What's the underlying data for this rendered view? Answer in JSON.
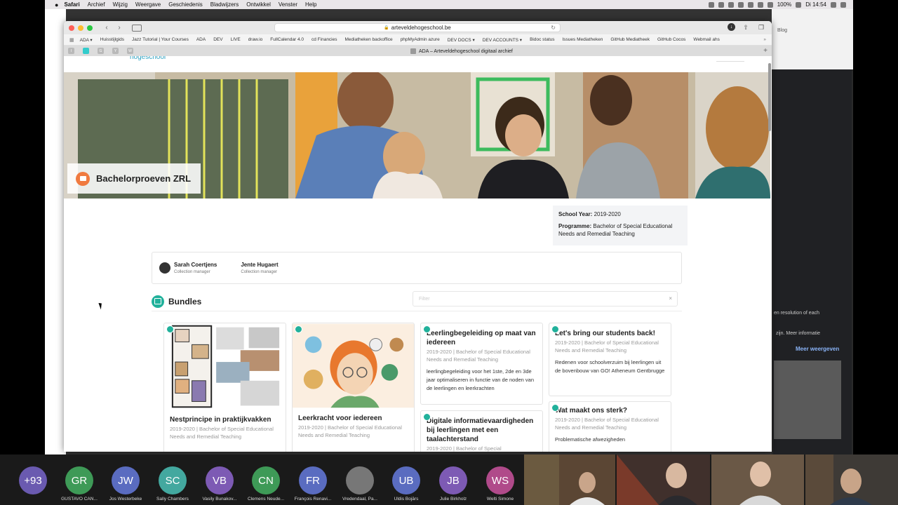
{
  "menubar": {
    "apple": "",
    "items": [
      "Safari",
      "Archief",
      "Wijzig",
      "Weergave",
      "Geschiedenis",
      "Bladwijzers",
      "Ontwikkel",
      "Venster",
      "Help"
    ],
    "battery": "100%",
    "clock": "Di 14:54"
  },
  "browser": {
    "url": "arteveldehogeschool.be",
    "bg_url": "react.semantic-ui.com",
    "bookmarks": [
      "ADA ▾",
      "Huisstijlgids",
      "Jazz Tutorial | Your Courses",
      "ADA",
      "DEV",
      "LIVE",
      "draw.io",
      "FullCalendar 4.0",
      "cd Financies",
      "Mediatheken backoffice",
      "phpMyAdmin azure",
      "DEV DOCS ▾",
      "DEV ACCOUNTS ▾",
      "Bidoc status",
      "Issues Mediatheken",
      "GitHub Mediatheek",
      "GitHub Cocos",
      "Webmail ahs"
    ],
    "pinned_tabs": [
      "I",
      "",
      "G",
      "Y",
      "W"
    ],
    "active_tab": "ADA – Arteveldehogeschool digitaal archief",
    "bookmarks_more": "»"
  },
  "page": {
    "logo_fragment": "hogeschool",
    "collection_title": "Bachelorproeven ZRL",
    "info": {
      "school_year_label": "School Year:",
      "school_year": "2019-2020",
      "programme_label": "Programme:",
      "programme": "Bachelor of Special Educational Needs and Remedial Teaching"
    },
    "managers": [
      {
        "name": "Sarah Coertjens",
        "role": "Collection manager"
      },
      {
        "name": "Jente Hugaert",
        "role": "Collection manager"
      }
    ],
    "bundles_title": "Bundles",
    "filter_placeholder": "Filter",
    "filter_clear": "×",
    "cards": [
      {
        "title": "Nestprincipe in praktijkvakken",
        "meta": "2019-2020 | Bachelor of Special Educational Needs and Remedial Teaching",
        "desc": ""
      },
      {
        "title": "Leerkracht voor iedereen",
        "meta": "2019-2020 | Bachelor of Special Educational Needs and Remedial Teaching",
        "desc": ""
      },
      {
        "title": "Leerlingbegeleiding op maat van iedereen",
        "meta": "2019-2020 | Bachelor of Special Educational Needs and Remedial Teaching",
        "desc": "leerlingbegeleiding voor het 1ste, 2de en 3de jaar optimaliseren in functie van de noden van de leerlingen en leerkrachten"
      },
      {
        "title": "Let's bring our students back!",
        "meta": "2019-2020 | Bachelor of Special Educational Needs and Remedial Teaching",
        "desc": "Redenen voor schoolverzuim bij leerlingen uit de bovenbouw van GO! Atheneum Gentbrugge"
      },
      {
        "title": "Digitale informatievaardigheden bij leerlingen met een taalachterstand",
        "meta": "2019-2020 | Bachelor of Special",
        "desc": ""
      },
      {
        "title": "Wat maakt ons sterk?",
        "meta": "2019-2020 | Bachelor of Special Educational Needs and Remedial Teaching",
        "desc": "Problematische afwezigheden"
      }
    ]
  },
  "background_window": {
    "tab_label": "Blog",
    "text1": "en resolution of each",
    "text2": "zijn. Meer informatie",
    "link": "Meer weergeven"
  },
  "zoom": {
    "more_count": "+93",
    "participants": [
      {
        "initials": "GR",
        "name": "GUSTAVO CAN...",
        "color": "#3e9a57"
      },
      {
        "initials": "JW",
        "name": "Jos Westerbeke",
        "color": "#5a6cc0"
      },
      {
        "initials": "SC",
        "name": "Sally Chambers",
        "color": "#43a89f"
      },
      {
        "initials": "VB",
        "name": "Vasily Bunakov...",
        "color": "#7d5ab4"
      },
      {
        "initials": "CN",
        "name": "Clemens Neude...",
        "color": "#3e9a57"
      },
      {
        "initials": "FR",
        "name": "François Renavi...",
        "color": "#5a6cc0"
      },
      {
        "initials": "",
        "name": "Vredendaal, Pa...",
        "color": "#777777"
      },
      {
        "initials": "UB",
        "name": "Uldis Bojārs",
        "color": "#5a6cc0"
      },
      {
        "initials": "JB",
        "name": "Julie Birkholz",
        "color": "#7d5ab4"
      },
      {
        "initials": "WS",
        "name": "Welti Simone",
        "color": "#b04a8a"
      }
    ],
    "more_color": "#6a5ab0"
  },
  "colors": {
    "accent_teal": "#21b19b",
    "accent_orange": "#f07a3f"
  }
}
